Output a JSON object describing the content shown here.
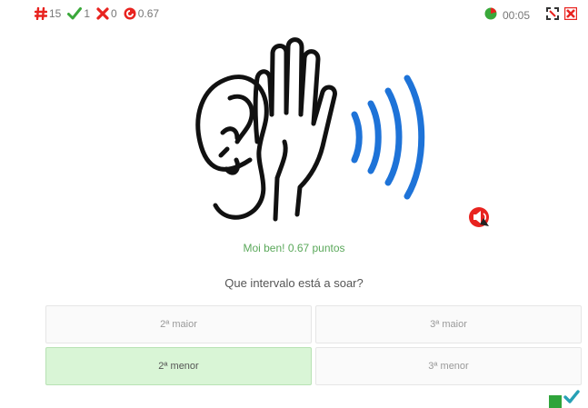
{
  "stats": {
    "total": "15",
    "correct": "1",
    "wrong": "0",
    "score": "0.67"
  },
  "timer": "00:05",
  "icons": {
    "total": "hash-icon",
    "correct": "check-icon",
    "wrong": "cross-icon",
    "score": "score-icon",
    "timer": "pie-timer-icon",
    "fullscreen": "fullscreen-icon",
    "close": "close-icon",
    "audio": "speaker-icon",
    "next": "next-check-icon"
  },
  "colors": {
    "red": "#e8231f",
    "green": "#3aa83a",
    "blue_waves": "#1e73d8",
    "selected_bg": "#d9f5d6"
  },
  "feedback": "Moi ben! 0.67 puntos",
  "question": "Que intervalo está a soar?",
  "options": [
    {
      "label": "2ª maior",
      "selected": false
    },
    {
      "label": "3ª maior",
      "selected": false
    },
    {
      "label": "2ª menor",
      "selected": true
    },
    {
      "label": "3ª menor",
      "selected": false
    }
  ]
}
